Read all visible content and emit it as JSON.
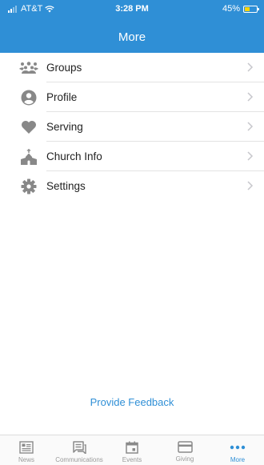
{
  "status_bar": {
    "carrier": "AT&T",
    "time": "3:28 PM",
    "battery": "45%",
    "battery_level": 0.45
  },
  "header": {
    "title": "More"
  },
  "menu": {
    "items": [
      {
        "label": "Groups",
        "icon": "groups-icon"
      },
      {
        "label": "Profile",
        "icon": "profile-icon"
      },
      {
        "label": "Serving",
        "icon": "heart-icon"
      },
      {
        "label": "Church Info",
        "icon": "church-icon"
      },
      {
        "label": "Settings",
        "icon": "gear-icon"
      }
    ]
  },
  "feedback_link": "Provide Feedback",
  "tabbar": {
    "tabs": [
      {
        "label": "News",
        "icon": "news-icon"
      },
      {
        "label": "Communications",
        "icon": "chat-icon"
      },
      {
        "label": "Events",
        "icon": "calendar-icon"
      },
      {
        "label": "Giving",
        "icon": "card-icon"
      },
      {
        "label": "More",
        "icon": "more-dots-icon",
        "active": true
      }
    ]
  },
  "colors": {
    "accent": "#2f8fd6",
    "icon_gray": "#888888",
    "chevron": "#c7c7cc",
    "battery_fill": "#ffd400"
  }
}
